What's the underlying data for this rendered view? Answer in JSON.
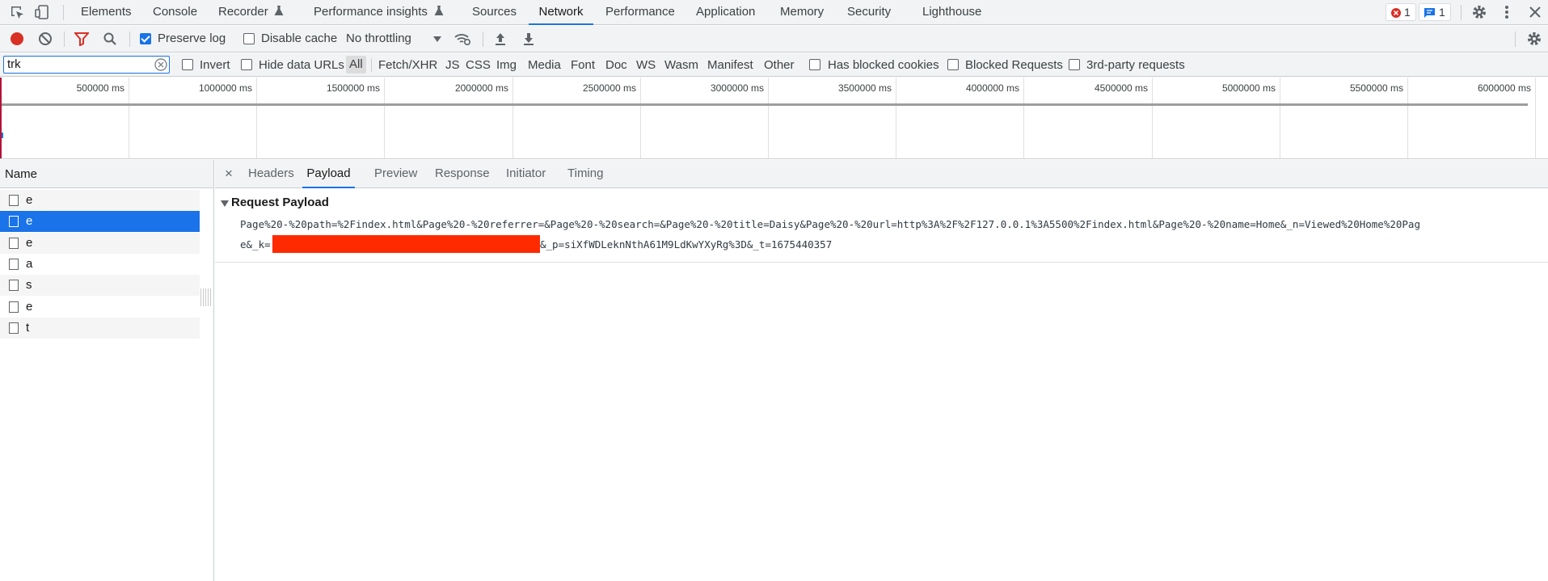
{
  "main_tabs": [
    {
      "label": "Elements",
      "active": false
    },
    {
      "label": "Console",
      "active": false
    },
    {
      "label": "Recorder",
      "active": false
    },
    {
      "label": "Performance insights",
      "active": false
    },
    {
      "label": "Sources",
      "active": false
    },
    {
      "label": "Network",
      "active": true
    },
    {
      "label": "Performance",
      "active": false
    },
    {
      "label": "Application",
      "active": false
    },
    {
      "label": "Memory",
      "active": false
    },
    {
      "label": "Security",
      "active": false
    },
    {
      "label": "Lighthouse",
      "active": false
    }
  ],
  "badges": {
    "errors": "1",
    "messages": "1"
  },
  "toolbar": {
    "preserve_log": "Preserve log",
    "preserve_log_checked": true,
    "disable_cache": "Disable cache",
    "disable_cache_checked": false,
    "throttling": "No throttling"
  },
  "filter": {
    "value": "trk",
    "invert": "Invert",
    "hide_data_urls": "Hide data URLs",
    "types": [
      "All",
      "Fetch/XHR",
      "JS",
      "CSS",
      "Img",
      "Media",
      "Font",
      "Doc",
      "WS",
      "Wasm",
      "Manifest",
      "Other"
    ],
    "active_type": "All",
    "has_blocked_cookies": "Has blocked cookies",
    "blocked_requests": "Blocked Requests",
    "third_party": "3rd-party requests"
  },
  "timeline": {
    "ticks": [
      "500000 ms",
      "1000000 ms",
      "1500000 ms",
      "2000000 ms",
      "2500000 ms",
      "3000000 ms",
      "3500000 ms",
      "4000000 ms",
      "4500000 ms",
      "5000000 ms",
      "5500000 ms",
      "6000000 ms"
    ]
  },
  "name_panel": {
    "header": "Name",
    "rows": [
      {
        "name": "e",
        "selected": false
      },
      {
        "name": "e",
        "selected": true
      },
      {
        "name": "e",
        "selected": false
      },
      {
        "name": "a",
        "selected": false
      },
      {
        "name": "s",
        "selected": false
      },
      {
        "name": "e",
        "selected": false
      },
      {
        "name": "t",
        "selected": false
      }
    ]
  },
  "detail": {
    "close": "×",
    "tabs": [
      {
        "label": "Headers",
        "active": false
      },
      {
        "label": "Payload",
        "active": true
      },
      {
        "label": "Preview",
        "active": false
      },
      {
        "label": "Response",
        "active": false
      },
      {
        "label": "Initiator",
        "active": false
      },
      {
        "label": "Timing",
        "active": false
      }
    ],
    "section_title": "Request Payload",
    "payload_line1": "Page%20-%20path=%2Findex.html&Page%20-%20referrer=&Page%20-%20search=&Page%20-%20title=Daisy&Page%20-%20url=http%3A%2F%2F127.0.0.1%3A5500%2Findex.html&Page%20-%20name=Home&_n=Viewed%20Home%20Pag",
    "payload_line2_start": "e&_k=",
    "payload_line2_end": "&_p=siXfWDLeknNthA61M9LdKwYXyRg%3D&_t=1675440357"
  },
  "colors": {
    "accent": "#1a73e8",
    "record": "#d93025",
    "redaction": "#ff2a00"
  }
}
